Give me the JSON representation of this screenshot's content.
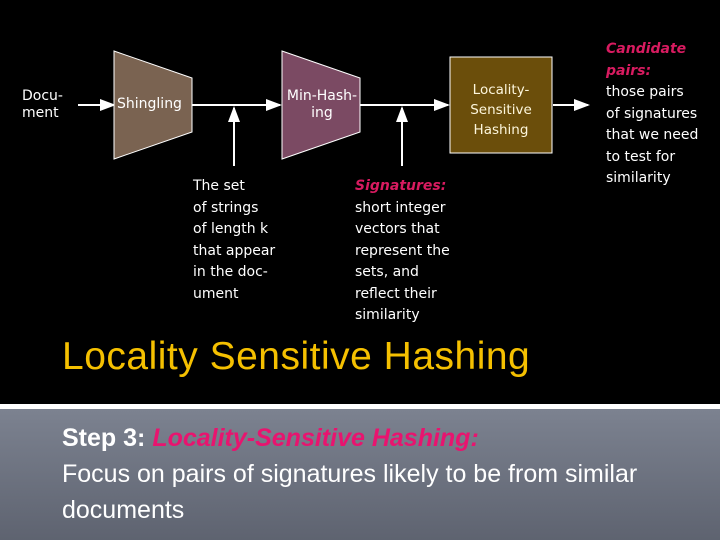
{
  "diagram": {
    "input_label": "Docu-\nment",
    "stages": [
      {
        "label": "Shingling",
        "color": "#7a6351"
      },
      {
        "label": "Min-Hash-\ning",
        "color": "#7b4a63"
      },
      {
        "label": "Locality-\nSensitive\nHashing",
        "color": "#6b4e0b"
      }
    ],
    "notes": {
      "shingles": {
        "lines": [
          "The set",
          "of strings",
          "of length k",
          "that appear",
          "in the doc-",
          "ument"
        ]
      },
      "signatures": {
        "heading": "Signatures:",
        "lines": [
          "short integer",
          "vectors that",
          "represent the",
          "sets, and",
          "reflect their",
          "similarity"
        ]
      },
      "candidates": {
        "heading": "Candidate pairs:",
        "lines": [
          "those pairs",
          "of signatures",
          "that we need",
          "to test for",
          "similarity"
        ]
      }
    }
  },
  "title": "Locality Sensitive Hashing",
  "body": {
    "step_label": "Step 3:",
    "step_name": "Locality-Sensitive Hashing:",
    "description": "Focus on pairs of signatures likely to be from similar documents"
  },
  "colors": {
    "title": "#f5c000",
    "highlight": "#e8146f"
  }
}
